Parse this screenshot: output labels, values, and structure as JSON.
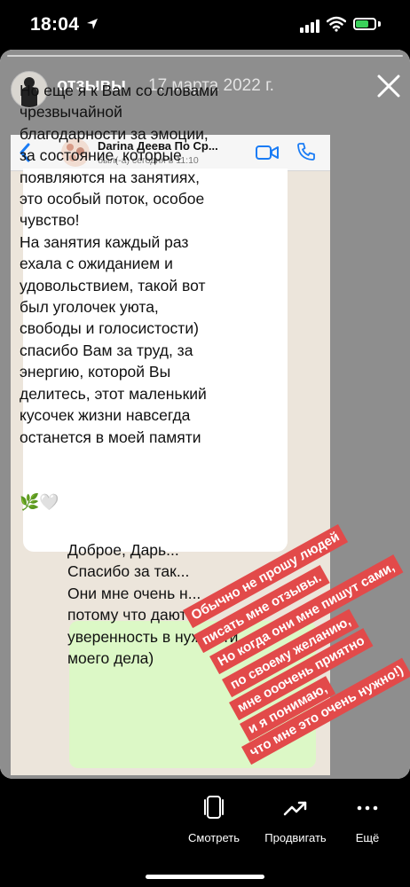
{
  "status_bar": {
    "time": "18:04"
  },
  "story": {
    "title": "отзывы",
    "date": "17 марта 2022 г."
  },
  "chat": {
    "contact_name": "Darina Деева По Ср...",
    "contact_status": "был(-а) сегодня в 11:10",
    "incoming_message": "Но еще я к Вам со словами\nчрезвычайной\nблагодарности за эмоции,\nза состояние, которые\nпоявляются на занятиях,\nэто особый поток, особое\nчувство!\nНа занятия каждый раз\nехала с ожиданием и\nудовольствием, такой вот\nбыл уголочек уюта,\nсвободы и голосистости)\nспасибо Вам за труд, за\nэнергию, которой Вы\nделитесь, этот маленький\nкусочек жизни навсегда\nостанется в моей памяти",
    "incoming_emoji": "🌿🤍",
    "outgoing_message": "Доброе, Дарь...\nСпасибо за так...\nОни мне очень н...\nпотому что дают\nуверенность в нуж...сти\nмоего дела)"
  },
  "stickers": [
    "Обычно не прошу людей",
    "писать мне отзывы.",
    "Но когда они мне пишут сами,",
    "по своему желанию,",
    "мне ооочень приятно",
    "и я понимаю,",
    "что мне это очень нужно!)"
  ],
  "actions": {
    "view": "Смотреть",
    "promote": "Продвигать",
    "more": "Ещё"
  },
  "colors": {
    "sticker_red": "#e24a4a",
    "outgoing_bubble": "#dcf8c6",
    "whatsapp_blue": "#1a7cf5"
  }
}
